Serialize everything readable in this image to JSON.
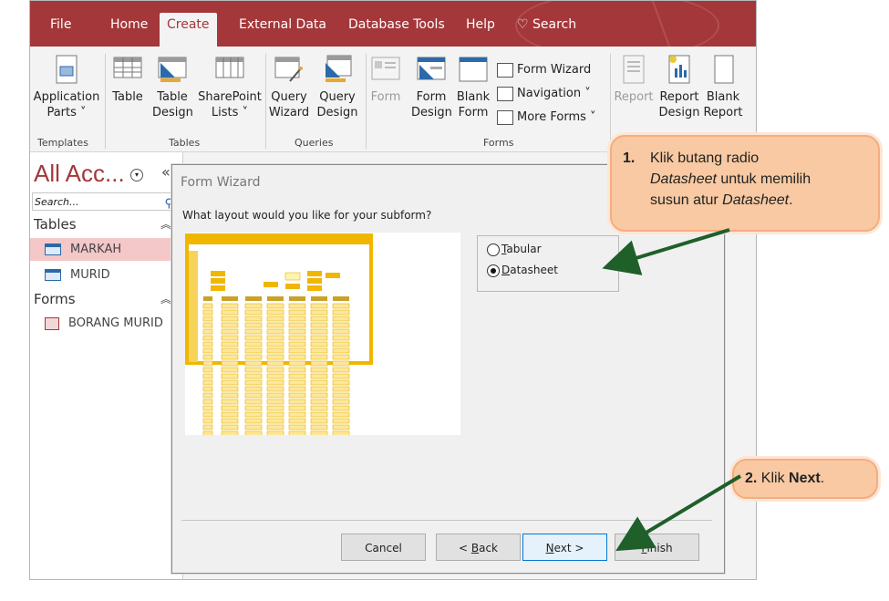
{
  "tabs": [
    "File",
    "Home",
    "Create",
    "External Data",
    "Database Tools",
    "Help"
  ],
  "active_tab": "Create",
  "search_tab": "Search",
  "ribbon": {
    "templates": {
      "group": "Templates",
      "application_parts": [
        "Application",
        "Parts ˅"
      ]
    },
    "tables": {
      "group": "Tables",
      "table": "Table",
      "table_design": [
        "Table",
        "Design"
      ],
      "sharepoint": [
        "SharePoint",
        "Lists ˅"
      ]
    },
    "queries": {
      "group": "Queries",
      "wizard": [
        "Query",
        "Wizard"
      ],
      "design": [
        "Query",
        "Design"
      ]
    },
    "forms": {
      "group": "Forms",
      "form": "Form",
      "form_design": [
        "Form",
        "Design"
      ],
      "blank_form": [
        "Blank",
        "Form"
      ],
      "form_wizard": "Form Wizard",
      "navigation": "Navigation ˅",
      "more_forms": "More Forms ˅"
    },
    "reports": {
      "report": "Report",
      "report_design": [
        "Report",
        "Design"
      ],
      "blank_report": [
        "Blank",
        "Report"
      ]
    }
  },
  "nav": {
    "title": "All Acc...",
    "search_placeholder": "Search...",
    "tables_header": "Tables",
    "tables": [
      "MARKAH",
      "MURID"
    ],
    "forms_header": "Forms",
    "forms": [
      "BORANG MURID"
    ]
  },
  "dialog": {
    "title": "Form Wizard",
    "question": "What layout would you like for your subform?",
    "options": [
      {
        "label": "Tabular",
        "mnemonic": "T",
        "rest": "abular",
        "selected": false
      },
      {
        "label": "Datasheet",
        "mnemonic": "D",
        "rest": "atasheet",
        "selected": true
      }
    ],
    "buttons": {
      "cancel": "Cancel",
      "back_prefix": "< ",
      "back_mn": "B",
      "back_rest": "ack",
      "next_mn": "N",
      "next_rest": "ext >",
      "finish_mn": "F",
      "finish_rest": "inish"
    }
  },
  "callouts": {
    "one_num": "1.",
    "one_a": "Klik butang radio",
    "one_b_italic": "Datasheet",
    "one_b_rest": " untuk memilih",
    "one_c_pre": "susun atur ",
    "one_c_italic": "Datasheet",
    "one_c_post": ".",
    "two_num": "2.",
    "two_pre": " Klik ",
    "two_bold": "Next",
    "two_post": "."
  },
  "colors": {
    "accent": "#a4373a",
    "callout_fill": "#f8c9a2",
    "arrow": "#1f5f2a"
  }
}
